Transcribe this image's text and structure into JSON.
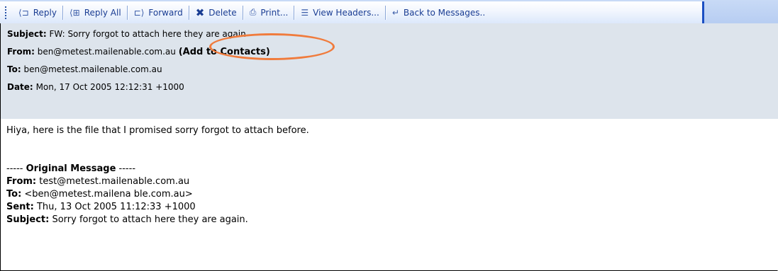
{
  "toolbar": {
    "buttons": [
      {
        "icon": "reply-icon",
        "glyph": "⟨⊐",
        "label": "Reply"
      },
      {
        "icon": "reply-all-icon",
        "glyph": "⟨⊞",
        "label": "Reply All"
      },
      {
        "icon": "forward-icon",
        "glyph": "⊏⟩",
        "label": "Forward"
      },
      {
        "icon": "delete-icon",
        "glyph": "✖",
        "label": "Delete"
      },
      {
        "icon": "print-icon",
        "glyph": "⎙",
        "label": "Print..."
      },
      {
        "icon": "view-headers-icon",
        "glyph": "☰",
        "label": "View Headers..."
      },
      {
        "icon": "back-icon",
        "glyph": "↵",
        "label": "Back to Messages.."
      }
    ]
  },
  "header": {
    "subject_label": "Subject:",
    "subject_value": "FW: Sorry forgot to attach here they are again",
    "from_label": "From:",
    "from_value": "ben@metest.mailenable.com.au",
    "add_contacts": "(Add to Contacts)",
    "to_label": "To:",
    "to_value": "ben@metest.mailenable.com.au",
    "date_label": "Date:",
    "date_value": "Mon, 17 Oct 2005 12:12:31 +1000"
  },
  "body": {
    "intro": "Hiya, here is the file that I promised sorry forgot to attach before.",
    "original_prefix": "----- ",
    "original_title": "Original Message",
    "original_suffix": " -----",
    "from_label": "From:",
    "from_value": " test@metest.mailenable.com.au",
    "to_label": "To:",
    "to_value": " <ben@metest.mailena ble.com.au>",
    "sent_label": "Sent:",
    "sent_value": " Thu, 13 Oct 2005 11:12:33 +1000",
    "subject_label": "Subject:",
    "subject_value": " Sorry forgot to attach here they are again."
  },
  "colors": {
    "toolbar_accent": "#1b4fc3",
    "header_bg": "#dde4ec",
    "highlight_oval": "#f07b3c"
  }
}
